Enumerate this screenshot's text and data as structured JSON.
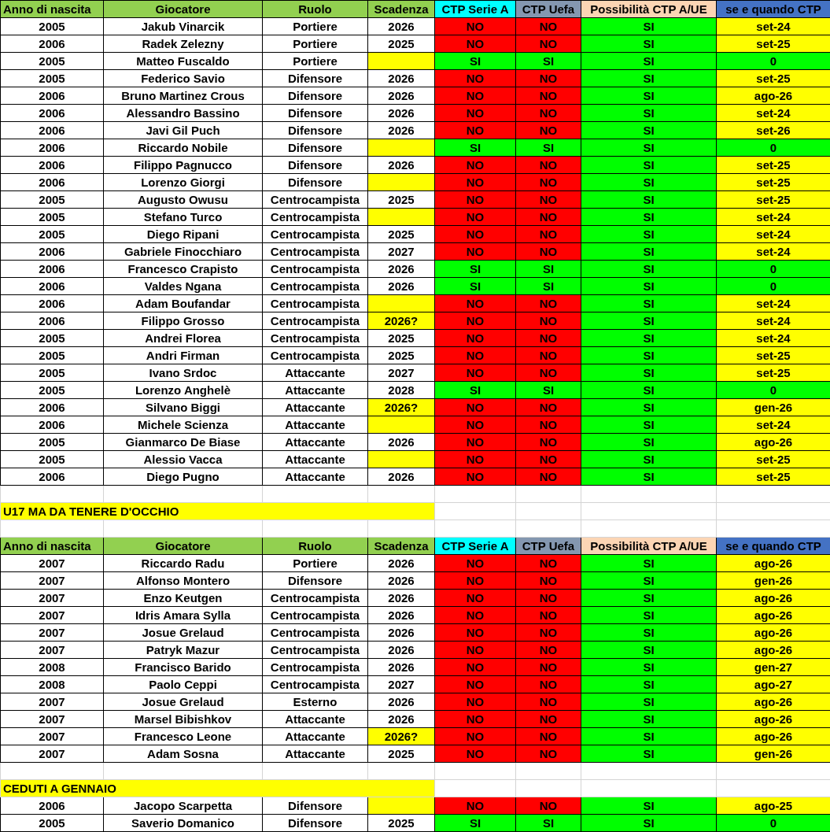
{
  "sections": [
    {
      "kind": "table",
      "columns": [
        {
          "label": "Anno di nascita",
          "color": "#92d050"
        },
        {
          "label": "Giocatore",
          "color": "#92d050"
        },
        {
          "label": "Ruolo",
          "color": "#92d050"
        },
        {
          "label": "Scadenza",
          "color": "#92d050"
        },
        {
          "label": "CTP Serie A",
          "color": "#00ffff"
        },
        {
          "label": "CTP Uefa",
          "color": "#8497b0"
        },
        {
          "label": "Possibilità CTP A/UE",
          "color": "#fcd5b4"
        },
        {
          "label": "se e quando CTP",
          "color": "#4472c4"
        }
      ],
      "rows": [
        {
          "anno": "2005",
          "giocatore": "Jakub Vinarcik",
          "ruolo": "Portiere",
          "scadenza": {
            "text": "2026",
            "flagged": false
          },
          "serie_a": {
            "text": "NO",
            "ok": false
          },
          "uefa": {
            "text": "NO",
            "ok": false
          },
          "possibilita": {
            "text": "SI",
            "ok": true
          },
          "quando": {
            "text": "set-24",
            "ok": false
          }
        },
        {
          "anno": "2006",
          "giocatore": "Radek Zelezny",
          "ruolo": "Portiere",
          "scadenza": {
            "text": "2025",
            "flagged": false
          },
          "serie_a": {
            "text": "NO",
            "ok": false
          },
          "uefa": {
            "text": "NO",
            "ok": false
          },
          "possibilita": {
            "text": "SI",
            "ok": true
          },
          "quando": {
            "text": "set-25",
            "ok": false
          }
        },
        {
          "anno": "2005",
          "giocatore": "Matteo Fuscaldo",
          "ruolo": "Portiere",
          "scadenza": {
            "flagged": true
          },
          "serie_a": {
            "text": "SI",
            "ok": true
          },
          "uefa": {
            "text": "SI",
            "ok": true
          },
          "possibilita": {
            "text": "SI",
            "ok": true
          },
          "quando": {
            "text": "0",
            "ok": true
          }
        },
        {
          "anno": "2005",
          "giocatore": "Federico Savio",
          "ruolo": "Difensore",
          "scadenza": {
            "text": "2026",
            "flagged": false
          },
          "serie_a": {
            "text": "NO",
            "ok": false
          },
          "uefa": {
            "text": "NO",
            "ok": false
          },
          "possibilita": {
            "text": "SI",
            "ok": true
          },
          "quando": {
            "text": "set-25",
            "ok": false
          }
        },
        {
          "anno": "2006",
          "giocatore": "Bruno Martinez Crous",
          "ruolo": "Difensore",
          "scadenza": {
            "text": "2026",
            "flagged": false
          },
          "serie_a": {
            "text": "NO",
            "ok": false
          },
          "uefa": {
            "text": "NO",
            "ok": false
          },
          "possibilita": {
            "text": "SI",
            "ok": true
          },
          "quando": {
            "text": "ago-26",
            "ok": false
          }
        },
        {
          "anno": "2006",
          "giocatore": "Alessandro Bassino",
          "ruolo": "Difensore",
          "scadenza": {
            "text": "2026",
            "flagged": false
          },
          "serie_a": {
            "text": "NO",
            "ok": false
          },
          "uefa": {
            "text": "NO",
            "ok": false
          },
          "possibilita": {
            "text": "SI",
            "ok": true
          },
          "quando": {
            "text": "set-24",
            "ok": false
          }
        },
        {
          "anno": "2006",
          "giocatore": "Javi Gil Puch",
          "ruolo": "Difensore",
          "scadenza": {
            "text": "2026",
            "flagged": false
          },
          "serie_a": {
            "text": "NO",
            "ok": false
          },
          "uefa": {
            "text": "NO",
            "ok": false
          },
          "possibilita": {
            "text": "SI",
            "ok": true
          },
          "quando": {
            "text": "set-26",
            "ok": false
          }
        },
        {
          "anno": "2006",
          "giocatore": "Riccardo Nobile",
          "ruolo": "Difensore",
          "scadenza": {
            "flagged": true
          },
          "serie_a": {
            "text": "SI",
            "ok": true
          },
          "uefa": {
            "text": "SI",
            "ok": true
          },
          "possibilita": {
            "text": "SI",
            "ok": true
          },
          "quando": {
            "text": "0",
            "ok": true
          }
        },
        {
          "anno": "2006",
          "giocatore": "Filippo Pagnucco",
          "ruolo": "Difensore",
          "scadenza": {
            "text": "2026",
            "flagged": false
          },
          "serie_a": {
            "text": "NO",
            "ok": false
          },
          "uefa": {
            "text": "NO",
            "ok": false
          },
          "possibilita": {
            "text": "SI",
            "ok": true
          },
          "quando": {
            "text": "set-25",
            "ok": false
          }
        },
        {
          "anno": "2006",
          "giocatore": "Lorenzo Giorgi",
          "ruolo": "Difensore",
          "scadenza": {
            "flagged": true
          },
          "serie_a": {
            "text": "NO",
            "ok": false
          },
          "uefa": {
            "text": "NO",
            "ok": false
          },
          "possibilita": {
            "text": "SI",
            "ok": true
          },
          "quando": {
            "text": "set-25",
            "ok": false
          }
        },
        {
          "anno": "2005",
          "giocatore": "Augusto Owusu",
          "ruolo": "Centrocampista",
          "scadenza": {
            "text": "2025",
            "flagged": false
          },
          "serie_a": {
            "text": "NO",
            "ok": false
          },
          "uefa": {
            "text": "NO",
            "ok": false
          },
          "possibilita": {
            "text": "SI",
            "ok": true
          },
          "quando": {
            "text": "set-25",
            "ok": false
          }
        },
        {
          "anno": "2005",
          "giocatore": "Stefano Turco",
          "ruolo": "Centrocampista",
          "scadenza": {
            "flagged": true
          },
          "serie_a": {
            "text": "NO",
            "ok": false
          },
          "uefa": {
            "text": "NO",
            "ok": false
          },
          "possibilita": {
            "text": "SI",
            "ok": true
          },
          "quando": {
            "text": "set-24",
            "ok": false
          }
        },
        {
          "anno": "2005",
          "giocatore": "Diego Ripani",
          "ruolo": "Centrocampista",
          "scadenza": {
            "text": "2025",
            "flagged": false
          },
          "serie_a": {
            "text": "NO",
            "ok": false
          },
          "uefa": {
            "text": "NO",
            "ok": false
          },
          "possibilita": {
            "text": "SI",
            "ok": true
          },
          "quando": {
            "text": "set-24",
            "ok": false
          }
        },
        {
          "anno": "2006",
          "giocatore": "Gabriele Finocchiaro",
          "ruolo": "Centrocampista",
          "scadenza": {
            "text": "2027",
            "flagged": false
          },
          "serie_a": {
            "text": "NO",
            "ok": false
          },
          "uefa": {
            "text": "NO",
            "ok": false
          },
          "possibilita": {
            "text": "SI",
            "ok": true
          },
          "quando": {
            "text": "set-24",
            "ok": false
          }
        },
        {
          "anno": "2006",
          "giocatore": "Francesco Crapisto",
          "ruolo": "Centrocampista",
          "scadenza": {
            "text": "2026",
            "flagged": false
          },
          "serie_a": {
            "text": "SI",
            "ok": true
          },
          "uefa": {
            "text": "SI",
            "ok": true
          },
          "possibilita": {
            "text": "SI",
            "ok": true
          },
          "quando": {
            "text": "0",
            "ok": true
          }
        },
        {
          "anno": "2006",
          "giocatore": "Valdes Ngana",
          "ruolo": "Centrocampista",
          "scadenza": {
            "text": "2026",
            "flagged": false
          },
          "serie_a": {
            "text": "SI",
            "ok": true
          },
          "uefa": {
            "text": "SI",
            "ok": true
          },
          "possibilita": {
            "text": "SI",
            "ok": true
          },
          "quando": {
            "text": "0",
            "ok": true
          }
        },
        {
          "anno": "2006",
          "giocatore": "Adam Boufandar",
          "ruolo": "Centrocampista",
          "scadenza": {
            "flagged": true
          },
          "serie_a": {
            "text": "NO",
            "ok": false
          },
          "uefa": {
            "text": "NO",
            "ok": false
          },
          "possibilita": {
            "text": "SI",
            "ok": true
          },
          "quando": {
            "text": "set-24",
            "ok": false
          }
        },
        {
          "anno": "2006",
          "giocatore": "Filippo Grosso",
          "ruolo": "Centrocampista",
          "scadenza": {
            "text": "2026?",
            "flagged": true
          },
          "serie_a": {
            "text": "NO",
            "ok": false
          },
          "uefa": {
            "text": "NO",
            "ok": false
          },
          "possibilita": {
            "text": "SI",
            "ok": true
          },
          "quando": {
            "text": "set-24",
            "ok": false
          }
        },
        {
          "anno": "2005",
          "giocatore": "Andrei Florea",
          "ruolo": "Centrocampista",
          "scadenza": {
            "text": "2025",
            "flagged": false
          },
          "serie_a": {
            "text": "NO",
            "ok": false
          },
          "uefa": {
            "text": "NO",
            "ok": false
          },
          "possibilita": {
            "text": "SI",
            "ok": true
          },
          "quando": {
            "text": "set-24",
            "ok": false
          }
        },
        {
          "anno": "2005",
          "giocatore": "Andri Firman",
          "ruolo": "Centrocampista",
          "scadenza": {
            "text": "2025",
            "flagged": false
          },
          "serie_a": {
            "text": "NO",
            "ok": false
          },
          "uefa": {
            "text": "NO",
            "ok": false
          },
          "possibilita": {
            "text": "SI",
            "ok": true
          },
          "quando": {
            "text": "set-25",
            "ok": false
          }
        },
        {
          "anno": "2005",
          "giocatore": "Ivano Srdoc",
          "ruolo": "Attaccante",
          "scadenza": {
            "text": "2027",
            "flagged": false
          },
          "serie_a": {
            "text": "NO",
            "ok": false
          },
          "uefa": {
            "text": "NO",
            "ok": false
          },
          "possibilita": {
            "text": "SI",
            "ok": true
          },
          "quando": {
            "text": "set-25",
            "ok": false
          }
        },
        {
          "anno": "2005",
          "giocatore": "Lorenzo Anghelè",
          "ruolo": "Attaccante",
          "scadenza": {
            "text": "2028",
            "flagged": false
          },
          "serie_a": {
            "text": "SI",
            "ok": true
          },
          "uefa": {
            "text": "SI",
            "ok": true
          },
          "possibilita": {
            "text": "SI",
            "ok": true
          },
          "quando": {
            "text": "0",
            "ok": true
          }
        },
        {
          "anno": "2006",
          "giocatore": "Silvano Biggi",
          "ruolo": "Attaccante",
          "scadenza": {
            "text": "2026?",
            "flagged": true
          },
          "serie_a": {
            "text": "NO",
            "ok": false
          },
          "uefa": {
            "text": "NO",
            "ok": false
          },
          "possibilita": {
            "text": "SI",
            "ok": true
          },
          "quando": {
            "text": "gen-26",
            "ok": false
          }
        },
        {
          "anno": "2006",
          "giocatore": "Michele Scienza",
          "ruolo": "Attaccante",
          "scadenza": {
            "flagged": true
          },
          "serie_a": {
            "text": "NO",
            "ok": false
          },
          "uefa": {
            "text": "NO",
            "ok": false
          },
          "possibilita": {
            "text": "SI",
            "ok": true
          },
          "quando": {
            "text": "set-24",
            "ok": false
          }
        },
        {
          "anno": "2005",
          "giocatore": "Gianmarco De Biase",
          "ruolo": "Attaccante",
          "scadenza": {
            "text": "2026",
            "flagged": false
          },
          "serie_a": {
            "text": "NO",
            "ok": false
          },
          "uefa": {
            "text": "NO",
            "ok": false
          },
          "possibilita": {
            "text": "SI",
            "ok": true
          },
          "quando": {
            "text": "ago-26",
            "ok": false
          }
        },
        {
          "anno": "2005",
          "giocatore": "Alessio Vacca",
          "ruolo": "Attaccante",
          "scadenza": {
            "flagged": true
          },
          "serie_a": {
            "text": "NO",
            "ok": false
          },
          "uefa": {
            "text": "NO",
            "ok": false
          },
          "possibilita": {
            "text": "SI",
            "ok": true
          },
          "quando": {
            "text": "set-25",
            "ok": false
          }
        },
        {
          "anno": "2006",
          "giocatore": "Diego Pugno",
          "ruolo": "Attaccante",
          "scadenza": {
            "text": "2026",
            "flagged": false
          },
          "serie_a": {
            "text": "NO",
            "ok": false
          },
          "uefa": {
            "text": "NO",
            "ok": false
          },
          "possibilita": {
            "text": "SI",
            "ok": true
          },
          "quando": {
            "text": "set-25",
            "ok": false
          }
        }
      ]
    },
    {
      "kind": "blank"
    },
    {
      "kind": "title",
      "title": "U17 MA DA TENERE D'OCCHIO"
    },
    {
      "kind": "blank"
    },
    {
      "kind": "table",
      "columns": [
        {
          "label": "Anno di nascita",
          "color": "#92d050"
        },
        {
          "label": "Giocatore",
          "color": "#92d050"
        },
        {
          "label": "Ruolo",
          "color": "#92d050"
        },
        {
          "label": "Scadenza",
          "color": "#92d050"
        },
        {
          "label": "CTP Serie A",
          "color": "#00ffff"
        },
        {
          "label": "CTP Uefa",
          "color": "#8497b0"
        },
        {
          "label": "Possibilità CTP A/UE",
          "color": "#fcd5b4"
        },
        {
          "label": "se e quando CTP",
          "color": "#4472c4"
        }
      ],
      "rows": [
        {
          "anno": "2007",
          "giocatore": "Riccardo Radu",
          "ruolo": "Portiere",
          "scadenza": {
            "text": "2026",
            "flagged": false
          },
          "serie_a": {
            "text": "NO",
            "ok": false
          },
          "uefa": {
            "text": "NO",
            "ok": false
          },
          "possibilita": {
            "text": "SI",
            "ok": true
          },
          "quando": {
            "text": "ago-26",
            "ok": false
          }
        },
        {
          "anno": "2007",
          "giocatore": "Alfonso Montero",
          "ruolo": "Difensore",
          "scadenza": {
            "text": "2026",
            "flagged": false
          },
          "serie_a": {
            "text": "NO",
            "ok": false
          },
          "uefa": {
            "text": "NO",
            "ok": false
          },
          "possibilita": {
            "text": "SI",
            "ok": true
          },
          "quando": {
            "text": "gen-26",
            "ok": false
          }
        },
        {
          "anno": "2007",
          "giocatore": "Enzo Keutgen",
          "ruolo": "Centrocampista",
          "scadenza": {
            "text": "2026",
            "flagged": false
          },
          "serie_a": {
            "text": "NO",
            "ok": false
          },
          "uefa": {
            "text": "NO",
            "ok": false
          },
          "possibilita": {
            "text": "SI",
            "ok": true
          },
          "quando": {
            "text": "ago-26",
            "ok": false
          }
        },
        {
          "anno": "2007",
          "giocatore": "Idris Amara Sylla",
          "ruolo": "Centrocampista",
          "scadenza": {
            "text": "2026",
            "flagged": false
          },
          "serie_a": {
            "text": "NO",
            "ok": false
          },
          "uefa": {
            "text": "NO",
            "ok": false
          },
          "possibilita": {
            "text": "SI",
            "ok": true
          },
          "quando": {
            "text": "ago-26",
            "ok": false
          }
        },
        {
          "anno": "2007",
          "giocatore": "Josue Grelaud",
          "ruolo": "Centrocampista",
          "scadenza": {
            "text": "2026",
            "flagged": false
          },
          "serie_a": {
            "text": "NO",
            "ok": false
          },
          "uefa": {
            "text": "NO",
            "ok": false
          },
          "possibilita": {
            "text": "SI",
            "ok": true
          },
          "quando": {
            "text": "ago-26",
            "ok": false
          }
        },
        {
          "anno": "2007",
          "giocatore": "Patryk Mazur",
          "ruolo": "Centrocampista",
          "scadenza": {
            "text": "2026",
            "flagged": false
          },
          "serie_a": {
            "text": "NO",
            "ok": false
          },
          "uefa": {
            "text": "NO",
            "ok": false
          },
          "possibilita": {
            "text": "SI",
            "ok": true
          },
          "quando": {
            "text": "ago-26",
            "ok": false
          }
        },
        {
          "anno": "2008",
          "giocatore": "Francisco Barido",
          "ruolo": "Centrocampista",
          "scadenza": {
            "text": "2026",
            "flagged": false
          },
          "serie_a": {
            "text": "NO",
            "ok": false
          },
          "uefa": {
            "text": "NO",
            "ok": false
          },
          "possibilita": {
            "text": "SI",
            "ok": true
          },
          "quando": {
            "text": "gen-27",
            "ok": false
          }
        },
        {
          "anno": "2008",
          "giocatore": "Paolo Ceppi",
          "ruolo": "Centrocampista",
          "scadenza": {
            "text": "2027",
            "flagged": false
          },
          "serie_a": {
            "text": "NO",
            "ok": false
          },
          "uefa": {
            "text": "NO",
            "ok": false
          },
          "possibilita": {
            "text": "SI",
            "ok": true
          },
          "quando": {
            "text": "ago-27",
            "ok": false
          }
        },
        {
          "anno": "2007",
          "giocatore": "Josue Grelaud",
          "ruolo": "Esterno",
          "scadenza": {
            "text": "2026",
            "flagged": false
          },
          "serie_a": {
            "text": "NO",
            "ok": false
          },
          "uefa": {
            "text": "NO",
            "ok": false
          },
          "possibilita": {
            "text": "SI",
            "ok": true
          },
          "quando": {
            "text": "ago-26",
            "ok": false
          }
        },
        {
          "anno": "2007",
          "giocatore": "Marsel Bibishkov",
          "ruolo": "Attaccante",
          "scadenza": {
            "text": "2026",
            "flagged": false
          },
          "serie_a": {
            "text": "NO",
            "ok": false
          },
          "uefa": {
            "text": "NO",
            "ok": false
          },
          "possibilita": {
            "text": "SI",
            "ok": true
          },
          "quando": {
            "text": "ago-26",
            "ok": false
          }
        },
        {
          "anno": "2007",
          "giocatore": "Francesco Leone",
          "ruolo": "Attaccante",
          "scadenza": {
            "text": "2026?",
            "flagged": true
          },
          "serie_a": {
            "text": "NO",
            "ok": false
          },
          "uefa": {
            "text": "NO",
            "ok": false
          },
          "possibilita": {
            "text": "SI",
            "ok": true
          },
          "quando": {
            "text": "ago-26",
            "ok": false
          }
        },
        {
          "anno": "2007",
          "giocatore": "Adam Sosna",
          "ruolo": "Attaccante",
          "scadenza": {
            "text": "2025",
            "flagged": false
          },
          "serie_a": {
            "text": "NO",
            "ok": false
          },
          "uefa": {
            "text": "NO",
            "ok": false
          },
          "possibilita": {
            "text": "SI",
            "ok": true
          },
          "quando": {
            "text": "gen-26",
            "ok": false
          }
        }
      ]
    },
    {
      "kind": "blank"
    },
    {
      "kind": "title",
      "title": "CEDUTI A GENNAIO"
    },
    {
      "kind": "table",
      "rows": [
        {
          "anno": "2006",
          "giocatore": "Jacopo Scarpetta",
          "ruolo": "Difensore",
          "scadenza": {
            "flagged": true
          },
          "serie_a": {
            "text": "NO",
            "ok": false
          },
          "uefa": {
            "text": "NO",
            "ok": false
          },
          "possibilita": {
            "text": "SI",
            "ok": true
          },
          "quando": {
            "text": "ago-25",
            "ok": false
          }
        },
        {
          "anno": "2005",
          "giocatore": "Saverio Domanico",
          "ruolo": "Difensore",
          "scadenza": {
            "text": "2025",
            "flagged": false
          },
          "serie_a": {
            "text": "SI",
            "ok": true
          },
          "uefa": {
            "text": "SI",
            "ok": true
          },
          "possibilita": {
            "text": "SI",
            "ok": true
          },
          "quando": {
            "text": "0",
            "ok": true
          }
        }
      ]
    }
  ]
}
